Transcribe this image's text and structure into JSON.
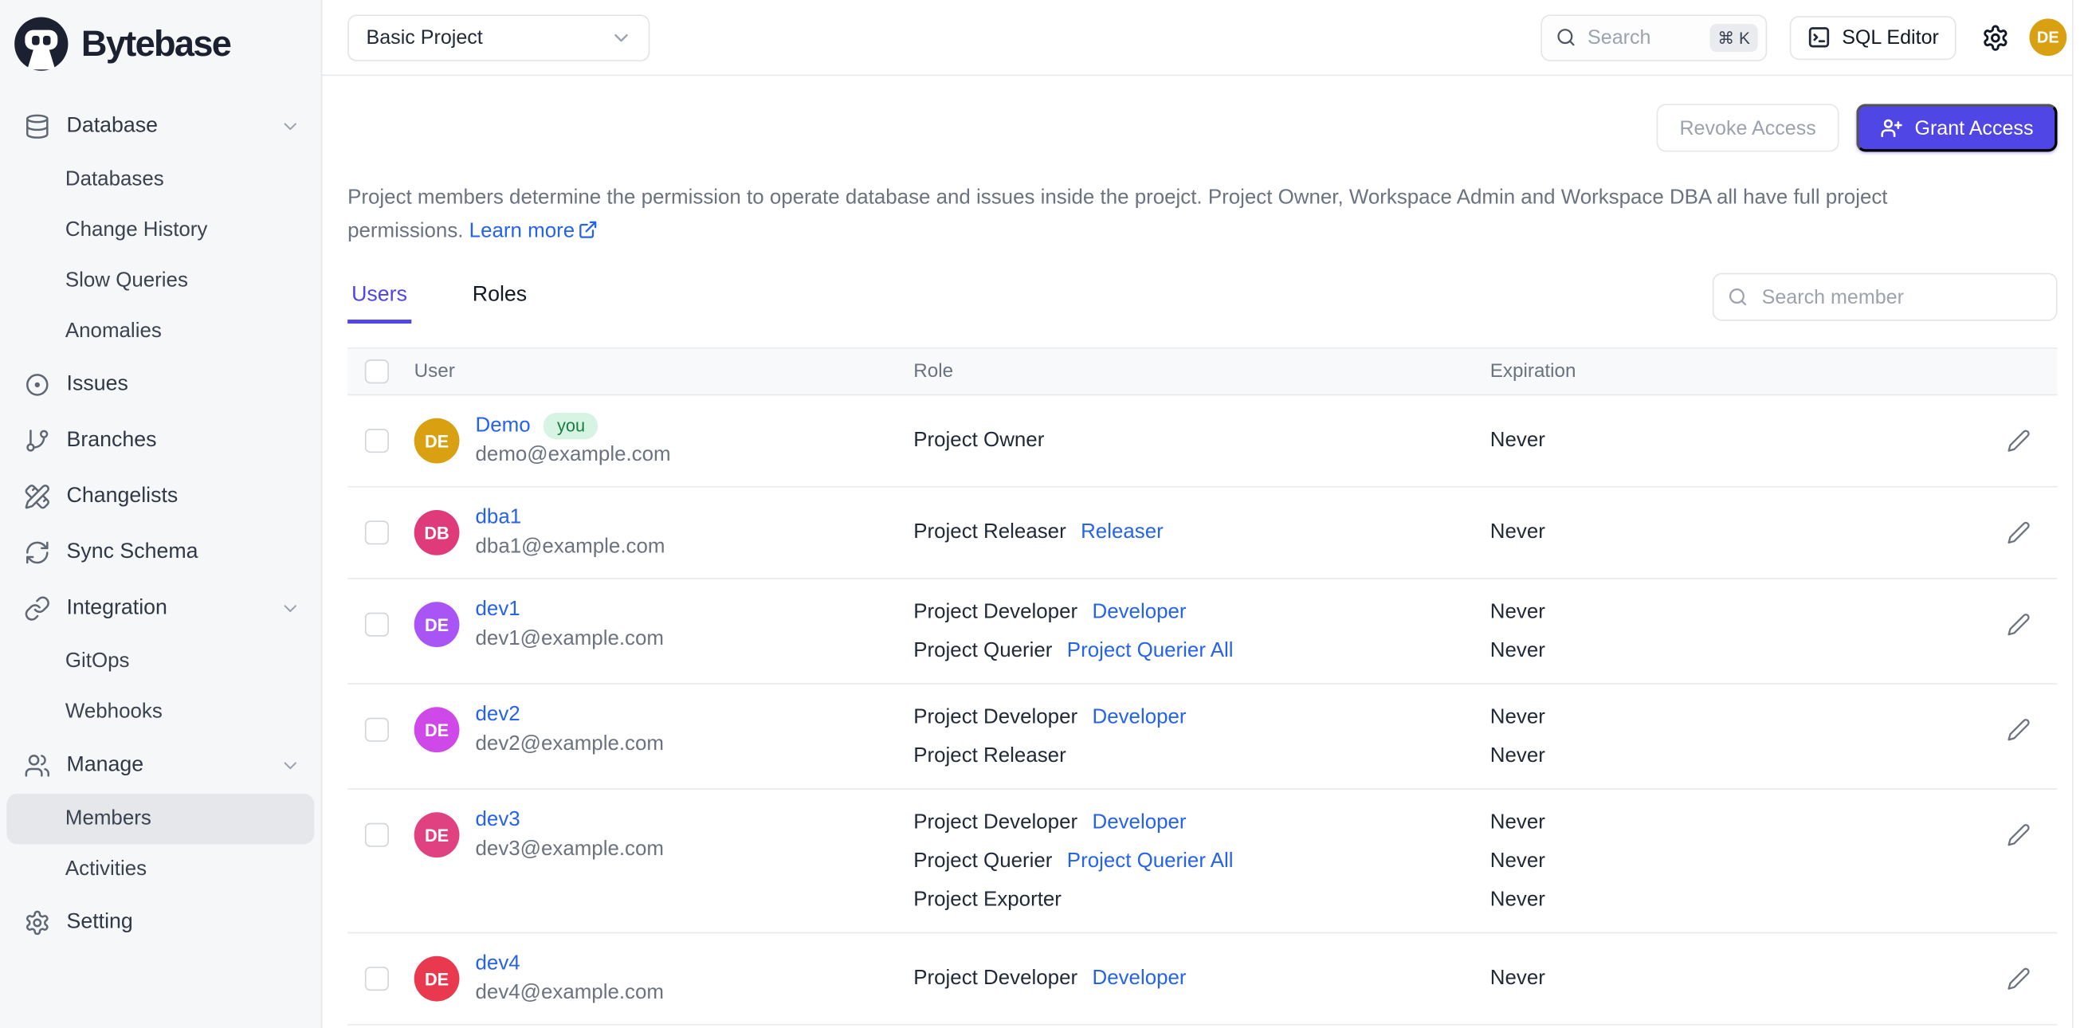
{
  "brand": {
    "name": "Bytebase"
  },
  "topbar": {
    "project_selector": "Basic Project",
    "search_placeholder": "Search",
    "search_shortcut": "⌘ K",
    "sql_editor_label": "SQL Editor",
    "avatar_initials": "DE",
    "avatar_color": "#d9a112"
  },
  "sidebar": {
    "items": [
      {
        "label": "Database",
        "icon": "database-icon",
        "chevron": true,
        "child": false,
        "active": false
      },
      {
        "label": "Databases",
        "icon": null,
        "chevron": false,
        "child": true,
        "active": false
      },
      {
        "label": "Change History",
        "icon": null,
        "chevron": false,
        "child": true,
        "active": false
      },
      {
        "label": "Slow Queries",
        "icon": null,
        "chevron": false,
        "child": true,
        "active": false
      },
      {
        "label": "Anomalies",
        "icon": null,
        "chevron": false,
        "child": true,
        "active": false
      },
      {
        "label": "Issues",
        "icon": "circle-dot-icon",
        "chevron": false,
        "child": false,
        "active": false
      },
      {
        "label": "Branches",
        "icon": "git-branch-icon",
        "chevron": false,
        "child": false,
        "active": false
      },
      {
        "label": "Changelists",
        "icon": "pencil-ruler-icon",
        "chevron": false,
        "child": false,
        "active": false
      },
      {
        "label": "Sync Schema",
        "icon": "refresh-icon",
        "chevron": false,
        "child": false,
        "active": false
      },
      {
        "label": "Integration",
        "icon": "link-icon",
        "chevron": true,
        "child": false,
        "active": false
      },
      {
        "label": "GitOps",
        "icon": null,
        "chevron": false,
        "child": true,
        "active": false
      },
      {
        "label": "Webhooks",
        "icon": null,
        "chevron": false,
        "child": true,
        "active": false
      },
      {
        "label": "Manage",
        "icon": "users-icon",
        "chevron": true,
        "child": false,
        "active": false
      },
      {
        "label": "Members",
        "icon": null,
        "chevron": false,
        "child": true,
        "active": true
      },
      {
        "label": "Activities",
        "icon": null,
        "chevron": false,
        "child": true,
        "active": false
      },
      {
        "label": "Setting",
        "icon": "gear-icon",
        "chevron": false,
        "child": false,
        "active": false
      }
    ]
  },
  "header": {
    "revoke_label": "Revoke Access",
    "grant_label": "Grant Access",
    "description": "Project members determine the permission to operate database and issues inside the proejct. Project Owner, Workspace Admin and Workspace DBA all have full project permissions. ",
    "learn_more_label": "Learn more"
  },
  "tabs": [
    {
      "label": "Users",
      "active": true
    },
    {
      "label": "Roles",
      "active": false
    }
  ],
  "search": {
    "member_placeholder": "Search member"
  },
  "table": {
    "columns": [
      "User",
      "Role",
      "Expiration"
    ],
    "rows": [
      {
        "initials": "DE",
        "avatar_color": "#d9a112",
        "name": "Demo",
        "you_badge": "you",
        "email": "demo@example.com",
        "roles": [
          {
            "role": "Project Owner",
            "link": "",
            "expiration": "Never"
          }
        ]
      },
      {
        "initials": "DB",
        "avatar_color": "#df3b7a",
        "name": "dba1",
        "you_badge": "",
        "email": "dba1@example.com",
        "roles": [
          {
            "role": "Project Releaser",
            "link": "Releaser",
            "expiration": "Never"
          }
        ]
      },
      {
        "initials": "DE",
        "avatar_color": "#a955f5",
        "name": "dev1",
        "you_badge": "",
        "email": "dev1@example.com",
        "roles": [
          {
            "role": "Project Developer",
            "link": "Developer",
            "expiration": "Never"
          },
          {
            "role": "Project Querier",
            "link": "Project Querier All",
            "expiration": "Never"
          }
        ]
      },
      {
        "initials": "DE",
        "avatar_color": "#cf49e8",
        "name": "dev2",
        "you_badge": "",
        "email": "dev2@example.com",
        "roles": [
          {
            "role": "Project Developer",
            "link": "Developer",
            "expiration": "Never"
          },
          {
            "role": "Project Releaser",
            "link": "",
            "expiration": "Never"
          }
        ]
      },
      {
        "initials": "DE",
        "avatar_color": "#e04181",
        "name": "dev3",
        "you_badge": "",
        "email": "dev3@example.com",
        "roles": [
          {
            "role": "Project Developer",
            "link": "Developer",
            "expiration": "Never"
          },
          {
            "role": "Project Querier",
            "link": "Project Querier All",
            "expiration": "Never"
          },
          {
            "role": "Project Exporter",
            "link": "",
            "expiration": "Never"
          }
        ]
      },
      {
        "initials": "DE",
        "avatar_color": "#e9394f",
        "name": "dev4",
        "you_badge": "",
        "email": "dev4@example.com",
        "roles": [
          {
            "role": "Project Developer",
            "link": "Developer",
            "expiration": "Never"
          }
        ]
      }
    ]
  }
}
